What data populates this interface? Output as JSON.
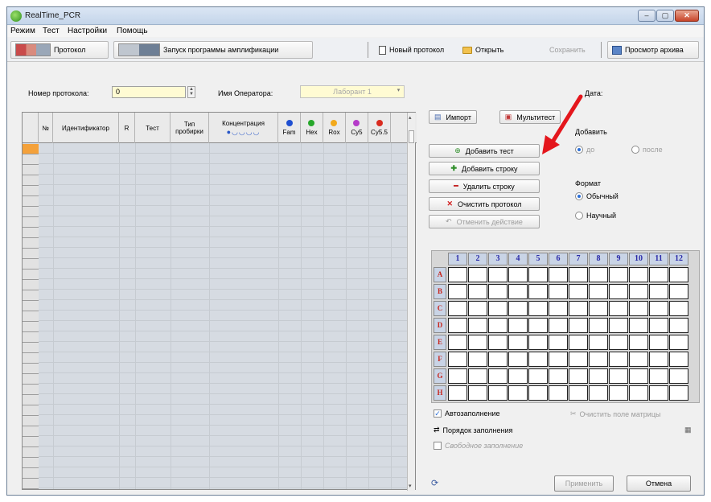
{
  "window": {
    "title": "RealTime_PCR",
    "controls": [
      "‒",
      "▢",
      "✕"
    ]
  },
  "menu": [
    "Режим",
    "Тест",
    "Настройки",
    "Помощь"
  ],
  "toolbar": {
    "protocol_label": "Протокол",
    "run_label": "Запуск программы амплификации",
    "new_protocol": "Новый протокол",
    "open": "Открыть",
    "save": "Сохранить",
    "archive": "Просмотр архива"
  },
  "form": {
    "protocol_number_label": "Номер протокола:",
    "protocol_number_value": "0",
    "operator_label": "Имя Оператора:",
    "operator_value": "Лаборант 1",
    "date_label": "Дата:"
  },
  "grid": {
    "columns": [
      "№",
      "Идентификатор",
      "R",
      "Тест",
      "Тип пробирки",
      "Концентрация",
      "Fam",
      "Hex",
      "Rox",
      "Cy5",
      "Cy5.5"
    ],
    "dye_colors": {
      "Fam": "#1f4fd1",
      "Hex": "#27a82b",
      "Rox": "#f2a91c",
      "Cy5": "#b53bc9",
      "Cy5.5": "#d92b1f"
    },
    "row_count": 33
  },
  "actions": {
    "import": "Импорт",
    "multitest": "Мультитест",
    "add_test": "Добавить тест",
    "add_row": "Добавить строку",
    "delete_row": "Удалить строку",
    "clear_protocol": "Очистить протокол",
    "undo": "Отменить действие"
  },
  "add_group": {
    "title": "Добавить",
    "before": "до",
    "after": "после"
  },
  "format_group": {
    "title": "Формат",
    "normal": "Обычный",
    "scientific": "Научный"
  },
  "plate": {
    "columns": [
      "1",
      "2",
      "3",
      "4",
      "5",
      "6",
      "7",
      "8",
      "9",
      "10",
      "11",
      "12"
    ],
    "rows": [
      "A",
      "B",
      "C",
      "D",
      "E",
      "F",
      "G",
      "H"
    ]
  },
  "plate_options": {
    "autofill": "Автозаполнение",
    "clear_matrix": "Очистить поле матрицы",
    "fill_order": "Порядок заполнения",
    "free_fill": "Свободное заполнение"
  },
  "footer": {
    "apply": "Применить",
    "cancel": "Отмена"
  }
}
